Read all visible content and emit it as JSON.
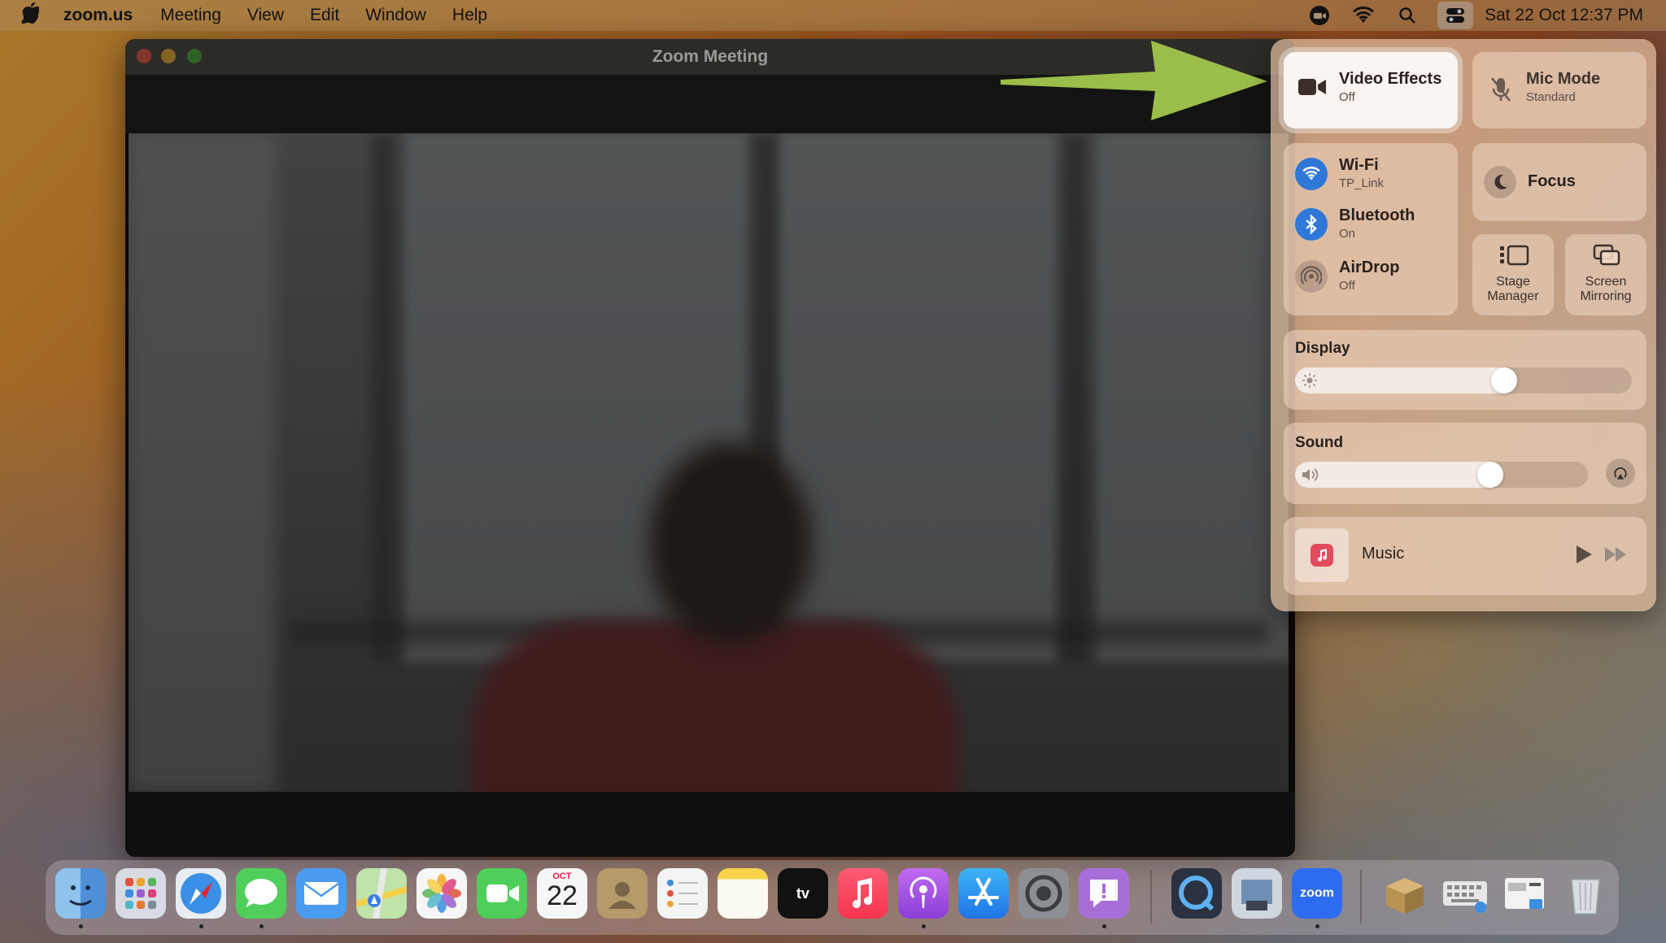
{
  "menubar": {
    "app_name": "zoom.us",
    "menus": [
      "Meeting",
      "View",
      "Edit",
      "Window",
      "Help"
    ],
    "clock": "Sat 22 Oct  12:37 PM"
  },
  "zoom_window": {
    "title": "Zoom Meeting"
  },
  "control_center": {
    "video_effects": {
      "title": "Video Effects",
      "status": "Off"
    },
    "mic_mode": {
      "title": "Mic Mode",
      "status": "Standard"
    },
    "wifi": {
      "title": "Wi-Fi",
      "status": "TP_Link"
    },
    "bluetooth": {
      "title": "Bluetooth",
      "status": "On"
    },
    "airdrop": {
      "title": "AirDrop",
      "status": "Off"
    },
    "focus": {
      "title": "Focus"
    },
    "stage_manager": {
      "title": "Stage Manager"
    },
    "screen_mirroring": {
      "title": "Screen Mirroring"
    },
    "display": {
      "title": "Display",
      "level": 0.66
    },
    "sound": {
      "title": "Sound",
      "level": 0.71
    },
    "music": {
      "title": "Music"
    }
  },
  "dock": {
    "calendar": {
      "month": "OCT",
      "day": "22"
    },
    "zoom_label": "zoom",
    "tv_label": "tv"
  },
  "colors": {
    "accent_blue": "#2f78d8",
    "arrow_green": "#9bbd4a",
    "tile_bg": "#fbf5f2"
  }
}
